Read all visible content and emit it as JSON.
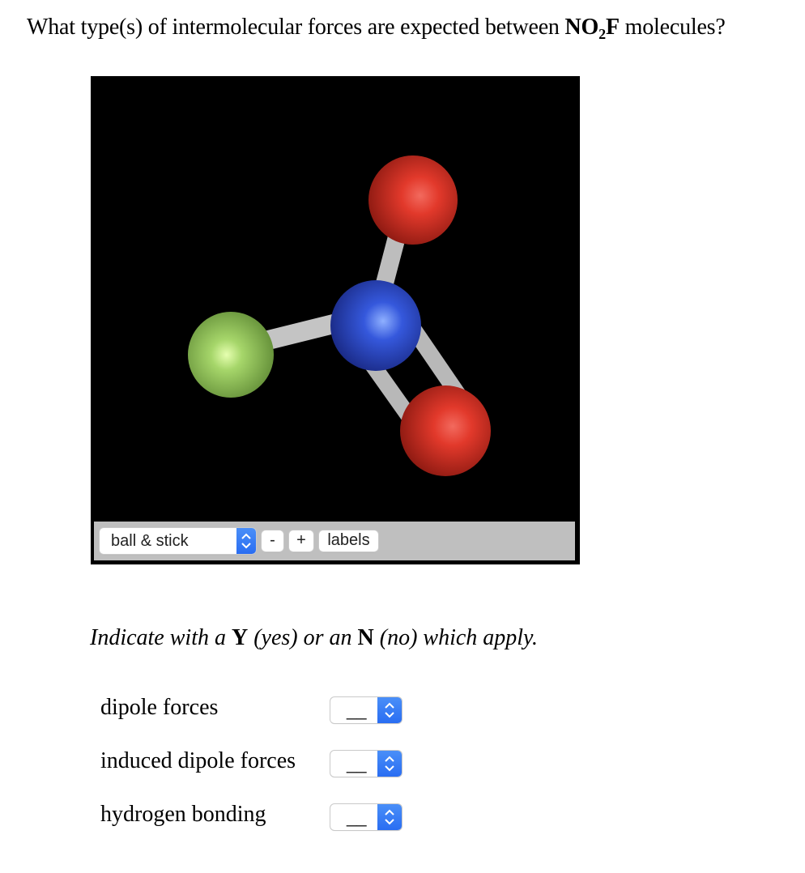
{
  "question": {
    "prefix": "What type(s) of intermolecular forces are expected between ",
    "formula_main": "NO",
    "formula_sub": "2",
    "formula_end": "F",
    "suffix": " molecules?"
  },
  "viewer": {
    "molecule": "NO2F",
    "render_style": "ball & stick",
    "atoms": [
      {
        "element": "O",
        "color": "#d8281e"
      },
      {
        "element": "N",
        "color": "#2f4fd6"
      },
      {
        "element": "F",
        "color": "#8fc35a"
      },
      {
        "element": "O",
        "color": "#d8281e"
      }
    ],
    "toolbar": {
      "style_select_value": "ball & stick",
      "zoom_out_label": "-",
      "zoom_in_label": "+",
      "labels_button": "labels"
    }
  },
  "instruction": {
    "part1": "Indicate with a ",
    "y": "Y",
    "part2": " (yes) or an ",
    "n": "N",
    "part3": " (no) which apply."
  },
  "options": [
    {
      "label": "dipole forces",
      "value": "__"
    },
    {
      "label": "induced dipole forces",
      "value": "__"
    },
    {
      "label": "hydrogen bonding",
      "value": "__"
    }
  ],
  "colors": {
    "accent_blue": "#3478f6",
    "toolbar_gray": "#bfbfbf"
  }
}
